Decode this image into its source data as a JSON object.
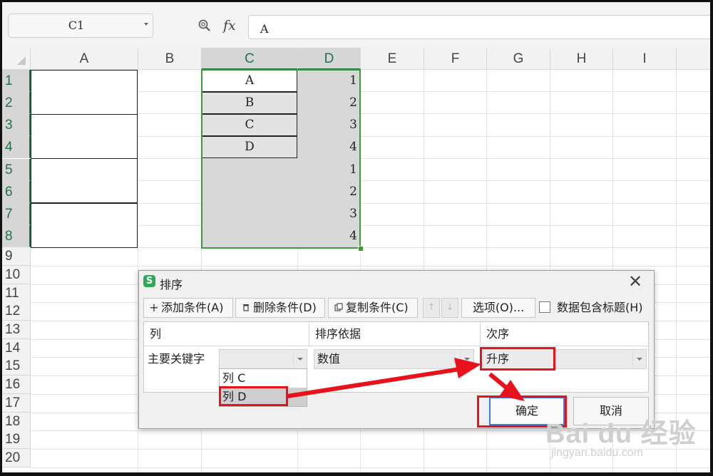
{
  "formula_bar": {
    "name_box": "C1",
    "fx_label": "fx",
    "formula_value": "A"
  },
  "columns": [
    "A",
    "B",
    "C",
    "D",
    "E",
    "F",
    "G",
    "H",
    "I"
  ],
  "rows": [
    "1",
    "2",
    "3",
    "4",
    "5",
    "6",
    "7",
    "8",
    "9",
    "10",
    "11",
    "12",
    "13",
    "14",
    "15",
    "16",
    "17",
    "18",
    "19",
    "20"
  ],
  "cells_c": [
    "A",
    "B",
    "C",
    "D"
  ],
  "cells_d": [
    "1",
    "2",
    "3",
    "4",
    "1",
    "2",
    "3",
    "4"
  ],
  "dialog": {
    "logo": "S",
    "title": "排序",
    "close": "✕",
    "add_condition": "添加条件(A)",
    "delete_condition": "删除条件(D)",
    "copy_condition": "复制条件(C)",
    "options": "选项(O)...",
    "has_header_label": "数据包含标题(H)",
    "header_col": "列",
    "header_sort_on": "排序依据",
    "header_order": "次序",
    "primary_key_label": "主要关键字",
    "column_value": "",
    "sort_on_value": "数值",
    "order_value": "升序",
    "dropdown_options": [
      "列 C",
      "列 D"
    ],
    "ok": "确定",
    "cancel": "取消"
  },
  "watermark": {
    "brand": "Bai du 经验",
    "url": "jingyan.baidu.com"
  },
  "colors": {
    "selection_green": "#3a9a3a",
    "annotation_red": "#e8131a",
    "ok_border_blue": "#3b7fd6",
    "wps_logo_green": "#2eaa57"
  },
  "icons": [
    "zoom-icon",
    "fx-icon",
    "plus-icon",
    "trash-icon",
    "copy-icon",
    "move-up-icon",
    "move-down-icon",
    "close-icon",
    "dropdown-arrow-icon"
  ]
}
